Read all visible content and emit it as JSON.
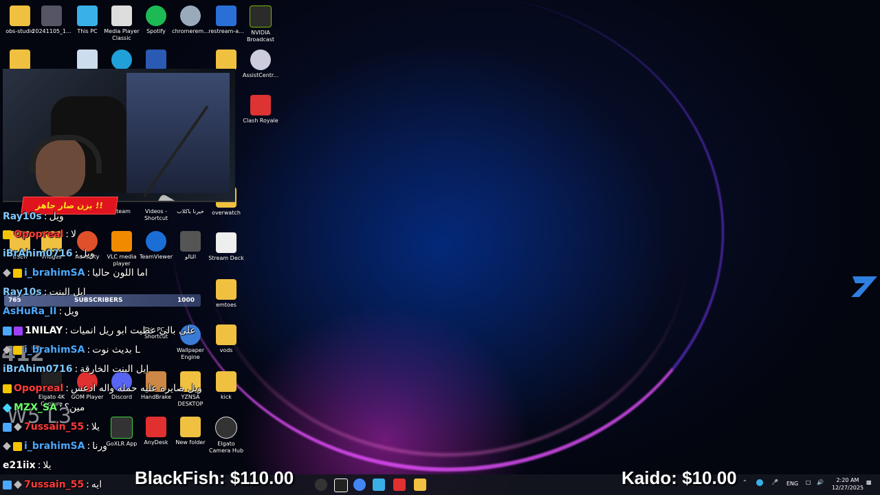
{
  "desktop": {
    "icons": [
      {
        "label": "obs-studio",
        "color": "#f0c040"
      },
      {
        "label": "20241105_1...",
        "color": "#556"
      },
      {
        "label": "This PC",
        "color": "#3ab0e8"
      },
      {
        "label": "Media Player Classic",
        "color": "#ddd"
      },
      {
        "label": "Spotify",
        "color": "#1db954"
      },
      {
        "label": "chromerem...",
        "color": "#9ab"
      },
      {
        "label": "restream-a...",
        "color": "#2a6fd6"
      },
      {
        "label": "NVIDIA Broadcast",
        "color": "#2b2b2b"
      },
      {
        "label": "AssistCentr...",
        "color": "#ccd"
      },
      {
        "label": "Clash Royale",
        "color": "#d33"
      },
      {
        "label": "overwatch",
        "color": "#f0c040"
      },
      {
        "label": "Stream Deck",
        "color": "#eee"
      },
      {
        "label": "emtoes",
        "color": "#f0c040"
      },
      {
        "label": "vods",
        "color": "#f0c040"
      },
      {
        "label": "kick",
        "color": "#f0c040"
      },
      {
        "label": "Elgato Camera Hub",
        "color": "#333"
      },
      {
        "label": "Steam",
        "color": "#234"
      },
      {
        "label": "Videos - Shortcut",
        "color": "#6a3ab0"
      },
      {
        "label": "خيرنا باكلاب",
        "color": "#444"
      },
      {
        "label": "USER",
        "color": "#f0c040"
      },
      {
        "label": "images",
        "color": "#f0c040"
      },
      {
        "label": "Audacity",
        "color": "#e0502a"
      },
      {
        "label": "VLC media player",
        "color": "#f28a00"
      },
      {
        "label": "TeamViewer",
        "color": "#1b6ed6"
      },
      {
        "label": "الثالو",
        "color": "#555"
      },
      {
        "label": "This PC - Shortcut",
        "color": "#3ab0e8"
      },
      {
        "label": "Wallpaper Engine",
        "color": "#3a7bd5"
      },
      {
        "label": "Elgato 4K Capture",
        "color": "#222"
      },
      {
        "label": "GOM Player",
        "color": "#e03030"
      },
      {
        "label": "Discord",
        "color": "#5865f2"
      },
      {
        "label": "HandBrake",
        "color": "#c84"
      },
      {
        "label": "YZNSA DESKTOP",
        "color": "#f0c040"
      },
      {
        "label": "GoXLR App",
        "color": "#333"
      },
      {
        "label": "AnyDesk",
        "color": "#e03030"
      },
      {
        "label": "New folder",
        "color": "#f0c040"
      }
    ]
  },
  "stream_overlay": {
    "banner": "يزن صار جاهز !!",
    "sub_goal": {
      "current": "765",
      "label": "SUBSCRIBERS",
      "target": "1000"
    },
    "big_number": "412",
    "w_text": "W5 L3",
    "tip_left": "BlackFish: $110.00",
    "tip_right": "Kaido: $10.00"
  },
  "chat": [
    {
      "user": "Ray10s",
      "user_color": "#7ec8ff",
      "text": "ويل",
      "badge": ""
    },
    {
      "user": "Opopreal",
      "user_color": "#ff3b3b",
      "text": "لا",
      "badge": "crown"
    },
    {
      "user": "iBrAhim0716",
      "user_color": "#7ec8ff",
      "text": "ويل",
      "badge": ""
    },
    {
      "user": "i_brahimSA",
      "user_color": "#4aa8ff",
      "text": "اما اللون حاليا",
      "badge": "crown"
    },
    {
      "user": "Ray10s",
      "user_color": "#7ec8ff",
      "text": "ايل البنت",
      "badge": ""
    },
    {
      "user": "AsHuRa_II",
      "user_color": "#4aa8ff",
      "text": "ويل",
      "badge": ""
    },
    {
      "user": "1NILAY",
      "user_color": "#ffffff",
      "text": "على بالي عطيت ابو ريل انميات",
      "badge": "multi"
    },
    {
      "user": "i_brahimSA",
      "user_color": "#4aa8ff",
      "text": "بديث نوت L",
      "badge": "crown"
    },
    {
      "user": "iBrAhim0716",
      "user_color": "#7ec8ff",
      "text": "ايل البنت الخارقة",
      "badge": ""
    },
    {
      "user": "Opopreal",
      "user_color": "#ff3b3b",
      "text": "ويل صايره عليه حمله واله ادعس",
      "badge": "crown"
    },
    {
      "user": "MZX_SA",
      "user_color": "#6dff6d",
      "text": "مين؟",
      "badge": "diamond"
    },
    {
      "user": "7ussain_55",
      "user_color": "#ff3b3b",
      "text": "يلا",
      "badge": "multi"
    },
    {
      "user": "i_brahimSA",
      "user_color": "#4aa8ff",
      "text": "ورنا",
      "badge": "crown"
    },
    {
      "user": "e21iix",
      "user_color": "#ffffff",
      "text": "يلا",
      "badge": ""
    },
    {
      "user": "7ussain_55",
      "user_color": "#ff3b3b",
      "text": "ايه",
      "badge": "multi"
    }
  ],
  "taskbar": {
    "language": "ENG",
    "time": "2:20 AM",
    "date": "12/27/2025"
  }
}
